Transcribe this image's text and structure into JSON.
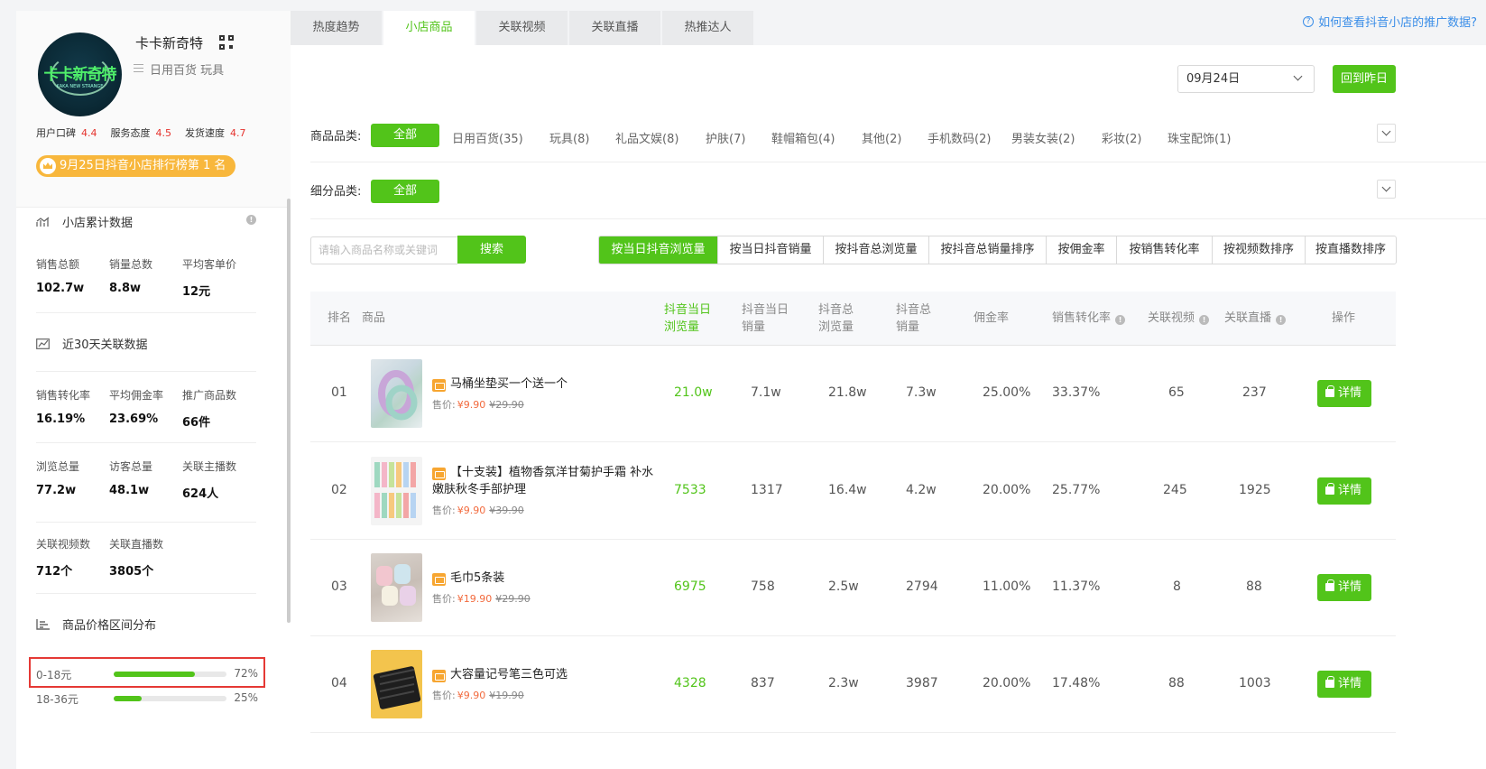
{
  "shop": {
    "logo_text": "卡卡新奇特",
    "logo_sub": "KAKA NEW STRANGE",
    "name": "卡卡新奇特",
    "categories": "日用百货 玩具",
    "ratings": [
      {
        "label": "用户口碑",
        "value": "4.4"
      },
      {
        "label": "服务态度",
        "value": "4.5"
      },
      {
        "label": "发货速度",
        "value": "4.7"
      }
    ],
    "rank_badge": "9月25日抖音小店排行榜第 1 名"
  },
  "cumulative": {
    "title": "小店累计数据",
    "metrics": [
      {
        "label": "销售总额",
        "value": "102.7w"
      },
      {
        "label": "销量总数",
        "value": "8.8w"
      },
      {
        "label": "平均客单价",
        "value": "12元"
      }
    ]
  },
  "recent30": {
    "title": "近30天关联数据",
    "metrics": [
      {
        "label": "销售转化率",
        "value": "16.19%"
      },
      {
        "label": "平均佣金率",
        "value": "23.69%"
      },
      {
        "label": "推广商品数",
        "value": "66件"
      },
      {
        "label": "浏览总量",
        "value": "77.2w"
      },
      {
        "label": "访客总量",
        "value": "48.1w"
      },
      {
        "label": "关联主播数",
        "value": "624人"
      },
      {
        "label": "关联视频数",
        "value": "712个"
      },
      {
        "label": "关联直播数",
        "value": "3805个"
      }
    ]
  },
  "price_dist": {
    "title": "商品价格区间分布",
    "rows": [
      {
        "range": "0-18元",
        "percent": "72%",
        "fraction": 0.72
      },
      {
        "range": "18-36元",
        "percent": "25%",
        "fraction": 0.25
      }
    ]
  },
  "tabs": [
    "热度趋势",
    "小店商品",
    "关联视频",
    "关联直播",
    "热推达人"
  ],
  "active_tab": 1,
  "help_link": "如何查看抖音小店的推广数据?",
  "date": "09月24日",
  "back_button": "回到昨日",
  "category_filter": {
    "label": "商品品类:",
    "all": "全部",
    "items": [
      "日用百货(35)",
      "玩具(8)",
      "礼品文娱(8)",
      "护肤(7)",
      "鞋帽箱包(4)",
      "其他(2)",
      "手机数码(2)",
      "男装女装(2)",
      "彩妆(2)",
      "珠宝配饰(1)"
    ]
  },
  "subcategory_filter": {
    "label": "细分品类:",
    "all": "全部"
  },
  "search": {
    "placeholder": "请输入商品名称或关键词",
    "button": "搜索"
  },
  "sort_buttons": [
    "按当日抖音浏览量",
    "按当日抖音销量",
    "按抖音总浏览量",
    "按抖音总销量排序",
    "按佣金率",
    "按销售转化率",
    "按视频数排序",
    "按直播数排序"
  ],
  "table": {
    "headers": {
      "rank": "排名",
      "product": "商品",
      "day_views": [
        "抖音当日",
        "浏览量"
      ],
      "day_sales": [
        "抖音当日",
        "销量"
      ],
      "total_views": [
        "抖音总",
        "浏览量"
      ],
      "total_sales": [
        "抖音总",
        "销量"
      ],
      "commission": "佣金率",
      "conversion": "销售转化率",
      "videos": "关联视频",
      "lives": "关联直播",
      "action": "操作"
    },
    "price_label": "售价:",
    "detail_label": "详情",
    "rows": [
      {
        "rank": "01",
        "name": "马桶坐垫买一个送一个",
        "price": "¥9.90",
        "old_price": "¥29.90",
        "day_views": "21.0w",
        "day_sales": "7.1w",
        "total_views": "21.8w",
        "total_sales": "7.3w",
        "commission": "25.00%",
        "conversion": "33.37%",
        "videos": "65",
        "lives": "237"
      },
      {
        "rank": "02",
        "name": "【十支装】植物香氛洋甘菊护手霜 补水嫩肤秋冬手部护理",
        "price": "¥9.90",
        "old_price": "¥39.90",
        "day_views": "7533",
        "day_sales": "1317",
        "total_views": "16.4w",
        "total_sales": "4.2w",
        "commission": "20.00%",
        "conversion": "25.77%",
        "videos": "245",
        "lives": "1925"
      },
      {
        "rank": "03",
        "name": "毛巾5条装",
        "price": "¥19.90",
        "old_price": "¥29.90",
        "day_views": "6975",
        "day_sales": "758",
        "total_views": "2.5w",
        "total_sales": "2794",
        "commission": "11.00%",
        "conversion": "11.37%",
        "videos": "8",
        "lives": "88"
      },
      {
        "rank": "04",
        "name": "大容量记号笔三色可选",
        "price": "¥9.90",
        "old_price": "¥19.90",
        "day_views": "4328",
        "day_sales": "837",
        "total_views": "2.3w",
        "total_sales": "3987",
        "commission": "20.00%",
        "conversion": "17.48%",
        "videos": "88",
        "lives": "1003"
      }
    ]
  }
}
